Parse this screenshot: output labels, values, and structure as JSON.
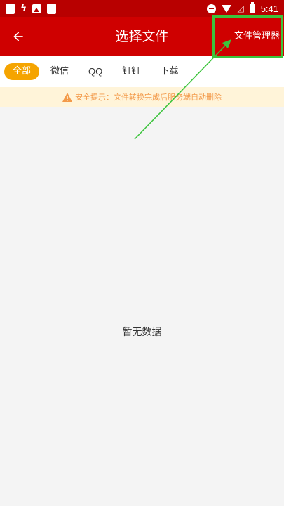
{
  "status_bar": {
    "time": "5:41",
    "icons": [
      "notification-square-icon",
      "lightning-icon",
      "image-icon",
      "notification-square-icon",
      "do-not-disturb-icon",
      "wifi-icon",
      "no-signal-icon",
      "battery-icon"
    ]
  },
  "app_bar": {
    "title": "选择文件",
    "back_icon": "arrow-left-icon",
    "file_manager_label": "文件管理器",
    "background": "#cf0000"
  },
  "tabs": [
    {
      "label": "全部",
      "active": true
    },
    {
      "label": "微信",
      "active": false
    },
    {
      "label": "QQ",
      "active": false
    },
    {
      "label": "钉钉",
      "active": false
    },
    {
      "label": "下载",
      "active": false
    }
  ],
  "notice": {
    "icon": "warning-icon",
    "text": "安全提示：文件转换完成后服务端自动删除"
  },
  "content": {
    "empty_text": "暂无数据"
  },
  "colors": {
    "accent": "#f5a400",
    "status_bar": "#b80000",
    "notice_text": "#f39a4a",
    "annotation": "#3cc43c"
  }
}
